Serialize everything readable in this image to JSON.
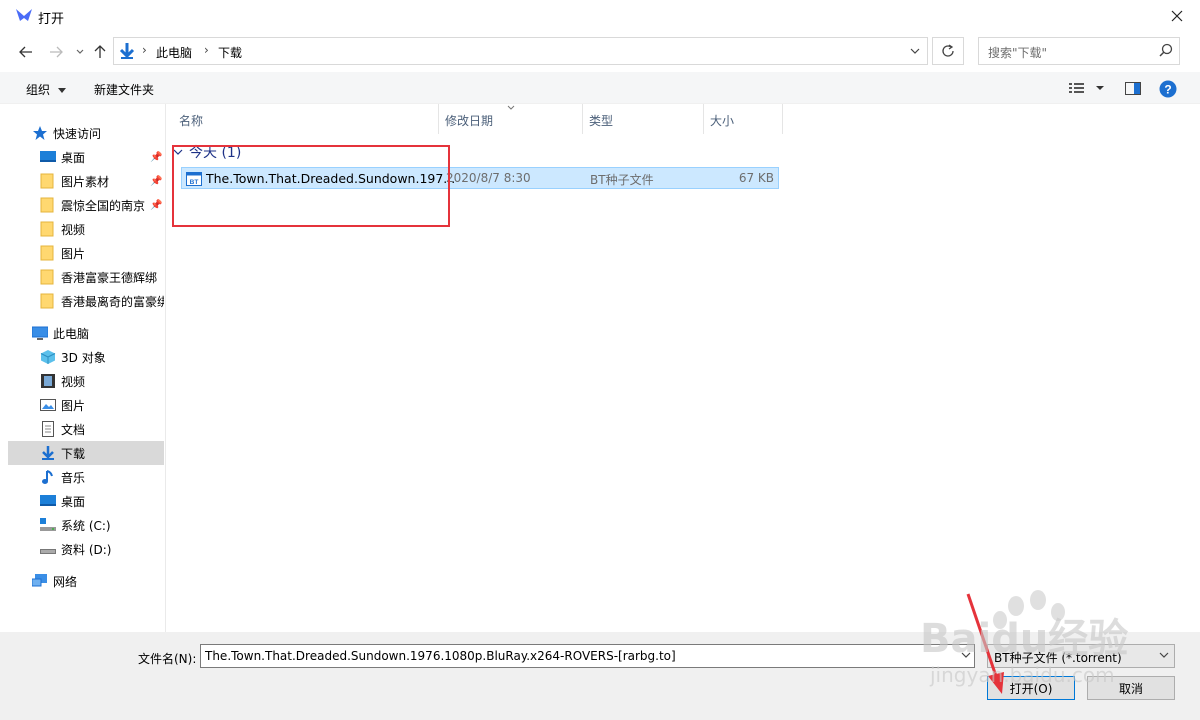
{
  "window": {
    "title": "打开"
  },
  "address": {
    "crumbs": [
      "此电脑",
      "下载"
    ],
    "search_placeholder": "搜索\"下载\""
  },
  "toolbar": {
    "organize": "组织",
    "new_folder": "新建文件夹"
  },
  "sidebar": {
    "quick_access": "快速访问",
    "quick_items": [
      "桌面",
      "图片素材",
      "震惊全国的南京",
      "视频",
      "图片",
      "香港富豪王德辉绑",
      "香港最离奇的富豪绑"
    ],
    "this_pc": "此电脑",
    "pc_items": [
      "3D 对象",
      "视频",
      "图片",
      "文档",
      "下载",
      "音乐",
      "桌面",
      "系统 (C:)",
      "资料 (D:)"
    ],
    "network": "网络"
  },
  "columns": [
    "名称",
    "修改日期",
    "类型",
    "大小"
  ],
  "group": {
    "label": "今天 (1)"
  },
  "file": {
    "name": "The.Town.That.Dreaded.Sundown.197...",
    "date": "2020/8/7 8:30",
    "type": "BT种子文件",
    "size": "67 KB"
  },
  "footer": {
    "filename_label": "文件名(N):",
    "filename_value": "The.Town.That.Dreaded.Sundown.1976.1080p.BluRay.x264-ROVERS-[rarbg.to]",
    "filter_value": "BT种子文件 (*.torrent)",
    "open_button": "打开(O)",
    "cancel_button": "取消"
  },
  "watermark": {
    "brand": "Baidu经验",
    "url": "jingyan.baidu.com"
  },
  "colors": {
    "accent": "#0078d7",
    "selected_row": "#cce8ff",
    "highlight": "#e5333b",
    "group_text": "#1e3287"
  }
}
